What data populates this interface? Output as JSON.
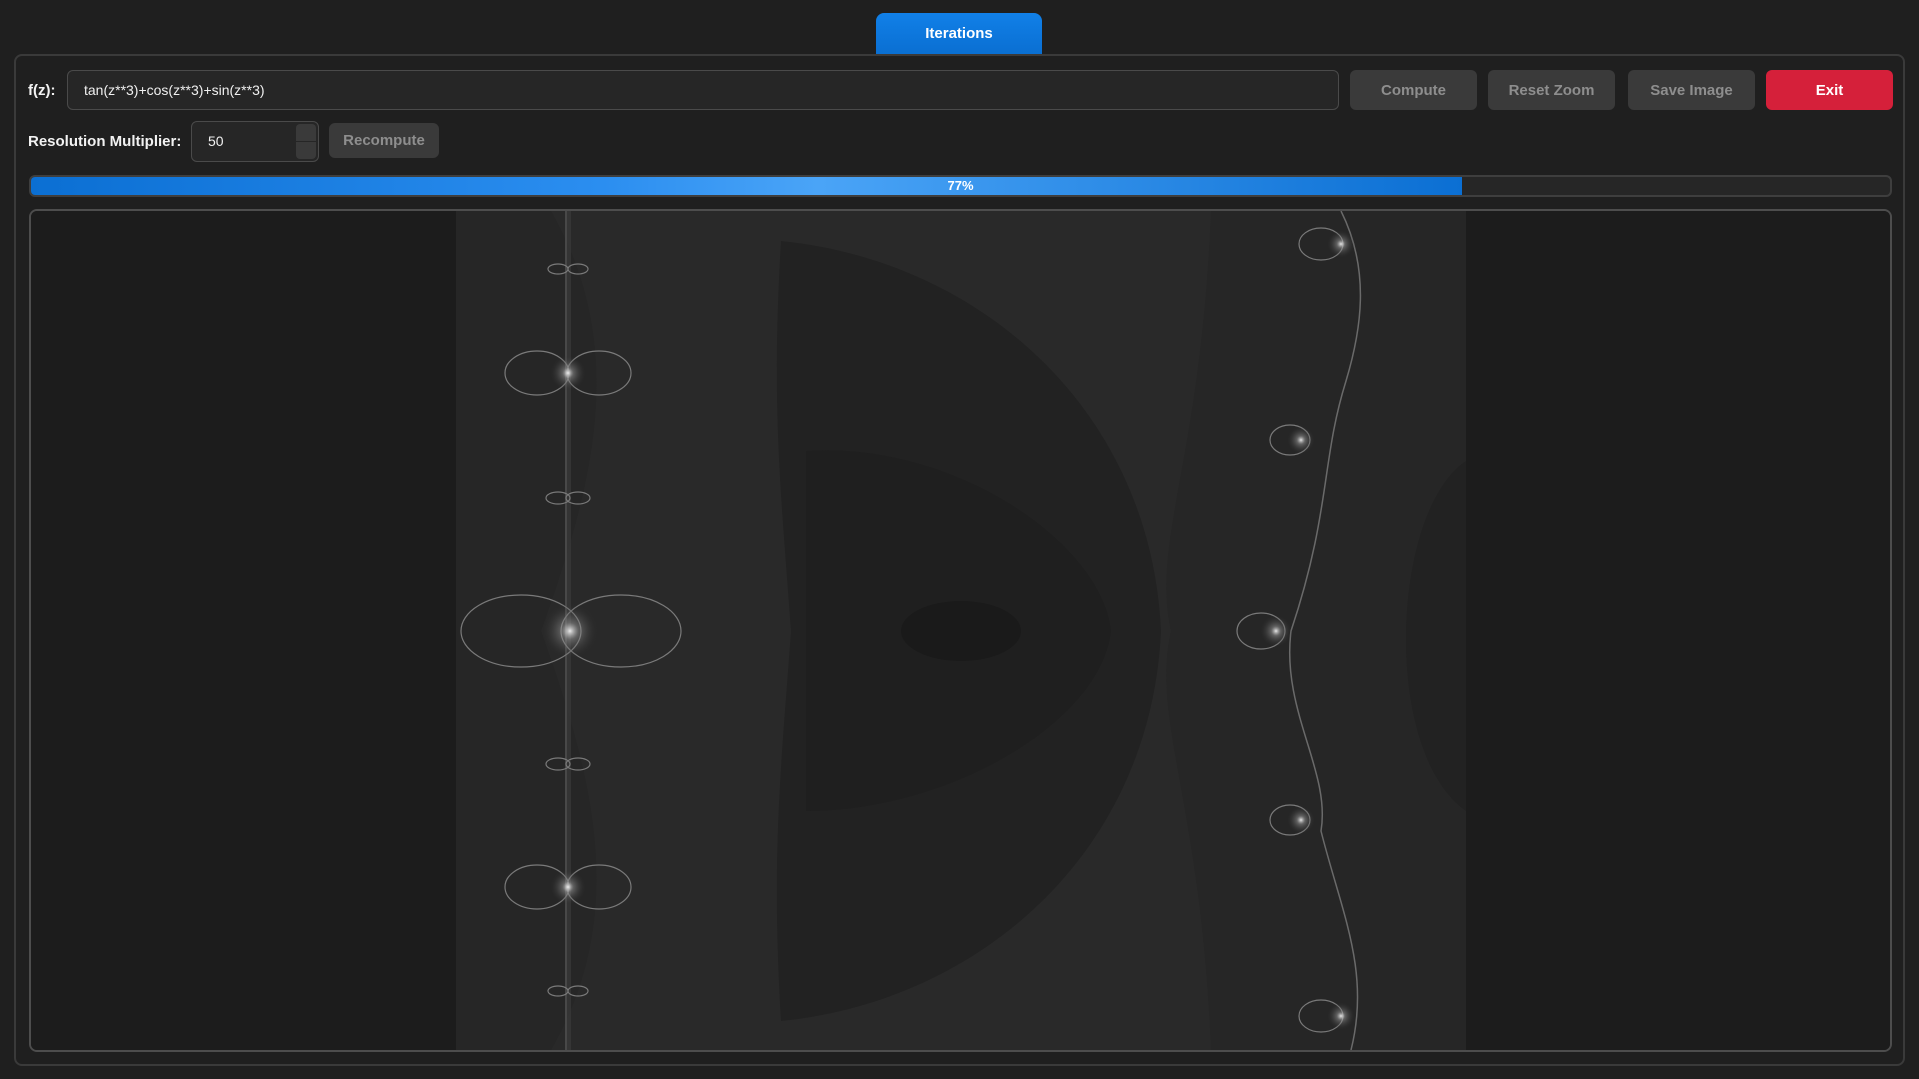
{
  "tab": {
    "label": "Iterations"
  },
  "formula": {
    "label": "f(z):",
    "value": "tan(z**3)+cos(z**3)+sin(z**3)"
  },
  "toolbar": {
    "compute_label": "Compute",
    "reset_zoom_label": "Reset Zoom",
    "save_image_label": "Save Image",
    "exit_label": "Exit"
  },
  "resolution": {
    "label": "Resolution Multiplier:",
    "value": "50",
    "recompute_label": "Recompute"
  },
  "progress": {
    "percent": 77,
    "text": "77%"
  },
  "colors": {
    "accent": "#0a6fd2",
    "exit": "#d5203a",
    "background": "#1f1f1f",
    "button_disabled": "#3a3a3a"
  }
}
